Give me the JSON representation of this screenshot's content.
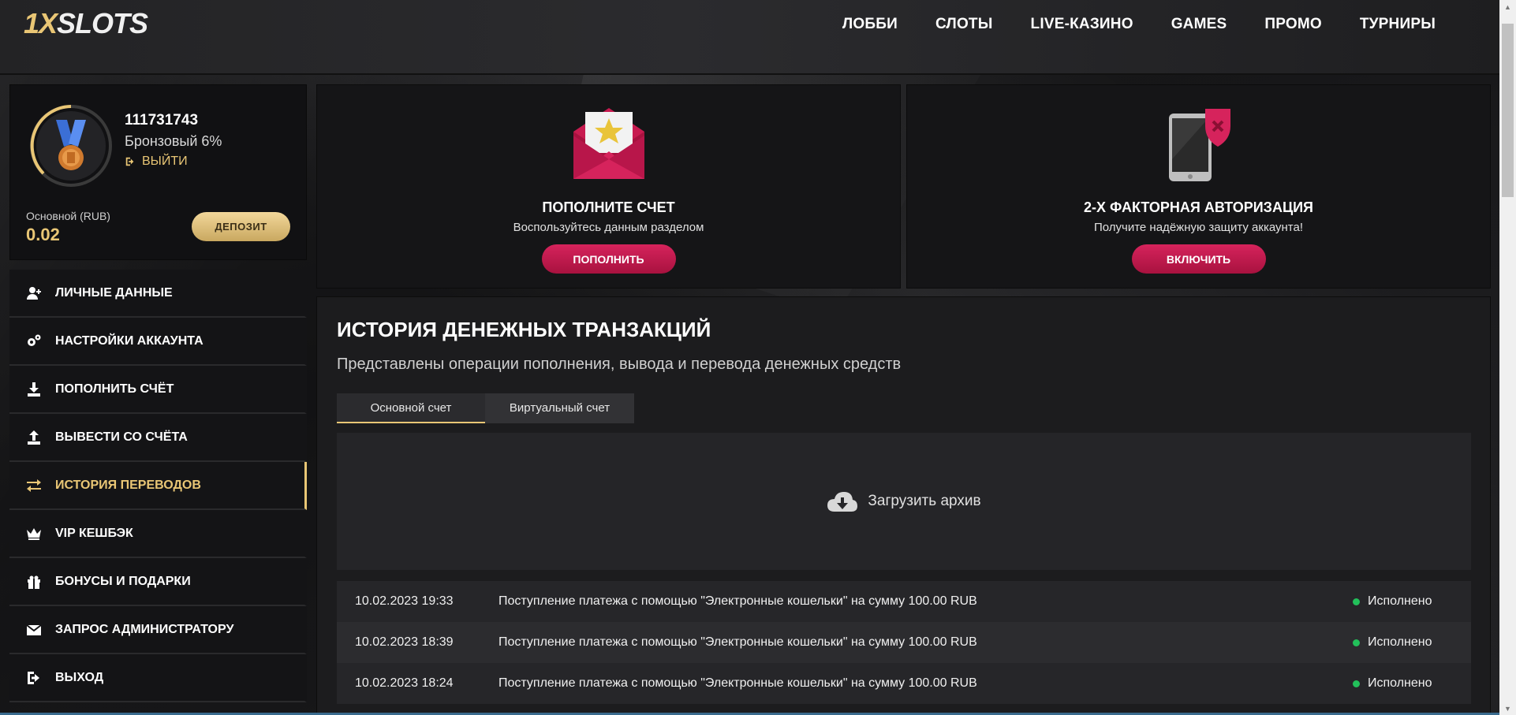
{
  "header": {
    "logo_prefix": "1X",
    "logo_suffix": "SLOTS",
    "nav": [
      "ЛОББИ",
      "СЛОТЫ",
      "LIVE-КАЗИНО",
      "GAMES",
      "ПРОМО",
      "ТУРНИРЫ"
    ]
  },
  "profile": {
    "user_id": "111731743",
    "level": "Бронзовый 6%",
    "logout_label": "ВЫЙТИ",
    "balance_label": "Основной (RUB)",
    "balance_value": "0.02",
    "deposit_label": "ДЕПОЗИТ"
  },
  "menu": [
    {
      "label": "ЛИЧНЫЕ ДАННЫЕ",
      "icon": "user-add-icon"
    },
    {
      "label": "НАСТРОЙКИ АККАУНТА",
      "icon": "gears-icon"
    },
    {
      "label": "ПОПОЛНИТЬ СЧЁТ",
      "icon": "download-icon"
    },
    {
      "label": "ВЫВЕСТИ СО СЧЁТА",
      "icon": "upload-icon"
    },
    {
      "label": "ИСТОРИЯ ПЕРЕВОДОВ",
      "icon": "transfer-arrows-icon",
      "active": true
    },
    {
      "label": "VIP КЕШБЭК",
      "icon": "crown-icon"
    },
    {
      "label": "БОНУСЫ И ПОДАРКИ",
      "icon": "gift-icon"
    },
    {
      "label": "ЗАПРОС АДМИНИСТРАТОРУ",
      "icon": "envelope-icon"
    },
    {
      "label": "ВЫХОД",
      "icon": "logout-icon"
    }
  ],
  "cards": {
    "deposit": {
      "title": "ПОПОЛНИТЕ СЧЕТ",
      "subtitle": "Воспользуйтесь данным разделом",
      "button": "ПОПОЛНИТЬ",
      "icon": "envelope-star-icon"
    },
    "twofa": {
      "title": "2-Х ФАКТОРНАЯ АВТОРИЗАЦИЯ",
      "subtitle": "Получите надёжную защиту аккаунта!",
      "button": "ВКЛЮЧИТЬ",
      "icon": "phone-shield-icon"
    }
  },
  "history": {
    "title": "ИСТОРИЯ ДЕНЕЖНЫХ ТРАНЗАКЦИЙ",
    "subtitle": "Представлены операции пополнения, вывода и перевода денежных средств",
    "tabs": [
      "Основной счет",
      "Виртуальный счет"
    ],
    "archive_label": "Загрузить архив",
    "rows": [
      {
        "date": "10.02.2023 19:33",
        "desc": "Поступление платежа с помощью \"Электронные кошельки\" на сумму 100.00 RUB",
        "status": "Исполнено"
      },
      {
        "date": "10.02.2023 18:39",
        "desc": "Поступление платежа с помощью \"Электронные кошельки\" на сумму 100.00 RUB",
        "status": "Исполнено"
      },
      {
        "date": "10.02.2023 18:24",
        "desc": "Поступление платежа с помощью \"Электронные кошельки\" на сумму 100.00 RUB",
        "status": "Исполнено"
      }
    ]
  },
  "colors": {
    "gold": "#e9c675",
    "pink": "#c81b50",
    "status_ok": "#22c05a"
  }
}
